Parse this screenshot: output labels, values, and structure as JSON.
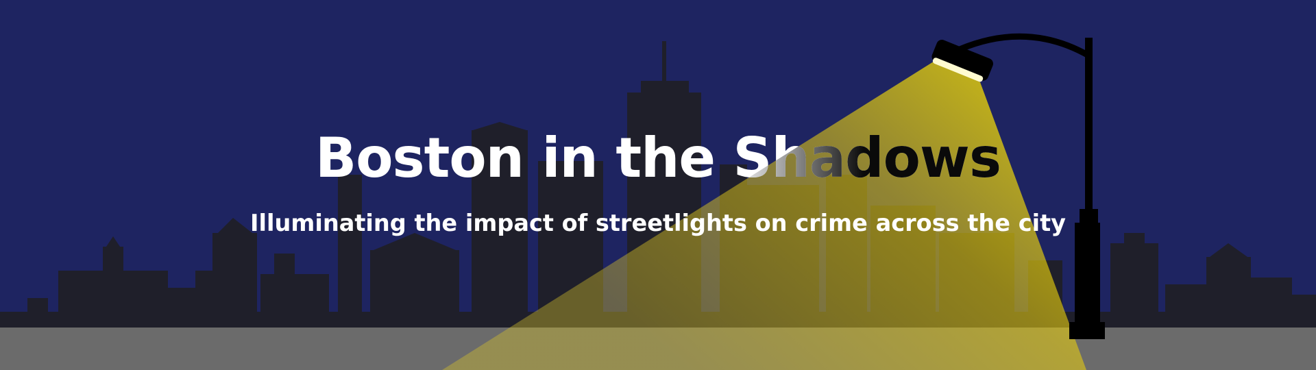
{
  "banner": {
    "title": "Boston in the Shadows",
    "subtitle": "Illuminating the impact of streetlights on crime across the city"
  },
  "colors": {
    "sky": "#1e2461",
    "skyline": "#1f1f2a",
    "ground": "#6b6b6b",
    "light_beam": "#f5dc00",
    "lamp_post": "#000000",
    "text": "#ffffff"
  },
  "icons": {
    "lamp": "streetlight-icon",
    "skyline": "city-skyline-icon"
  }
}
